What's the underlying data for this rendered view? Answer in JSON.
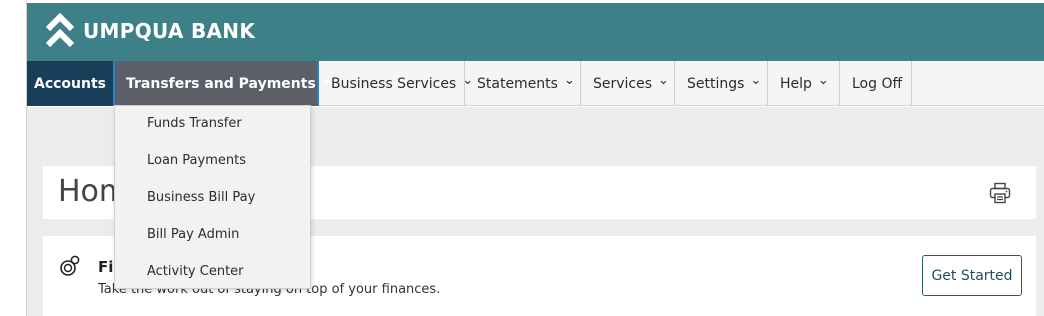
{
  "brand": {
    "name": "UMPQUA BANK",
    "header_color": "#3e8087"
  },
  "nav": {
    "items": [
      {
        "label": "Accounts"
      },
      {
        "label": "Transfers and Payments",
        "chevron": "⌃"
      },
      {
        "label": "Business Services",
        "chevron": "⌄"
      },
      {
        "label": "Statements",
        "chevron": "⌄"
      },
      {
        "label": "Services",
        "chevron": "⌄"
      },
      {
        "label": "Settings",
        "chevron": "⌄"
      },
      {
        "label": "Help",
        "chevron": "⌄"
      },
      {
        "label": "Log Off"
      }
    ]
  },
  "dropdown": {
    "items": [
      {
        "label": "Funds Transfer"
      },
      {
        "label": "Loan Payments"
      },
      {
        "label": "Business Bill Pay"
      },
      {
        "label": "Bill Pay Admin"
      },
      {
        "label": "Activity Center"
      }
    ]
  },
  "page": {
    "title": "Hom",
    "print_icon": "printer-icon"
  },
  "finances_card": {
    "title": "Fi",
    "description": "Take the work out of staying on top of your finances.",
    "button_label": "Get Started",
    "icon": "coins-icon"
  }
}
